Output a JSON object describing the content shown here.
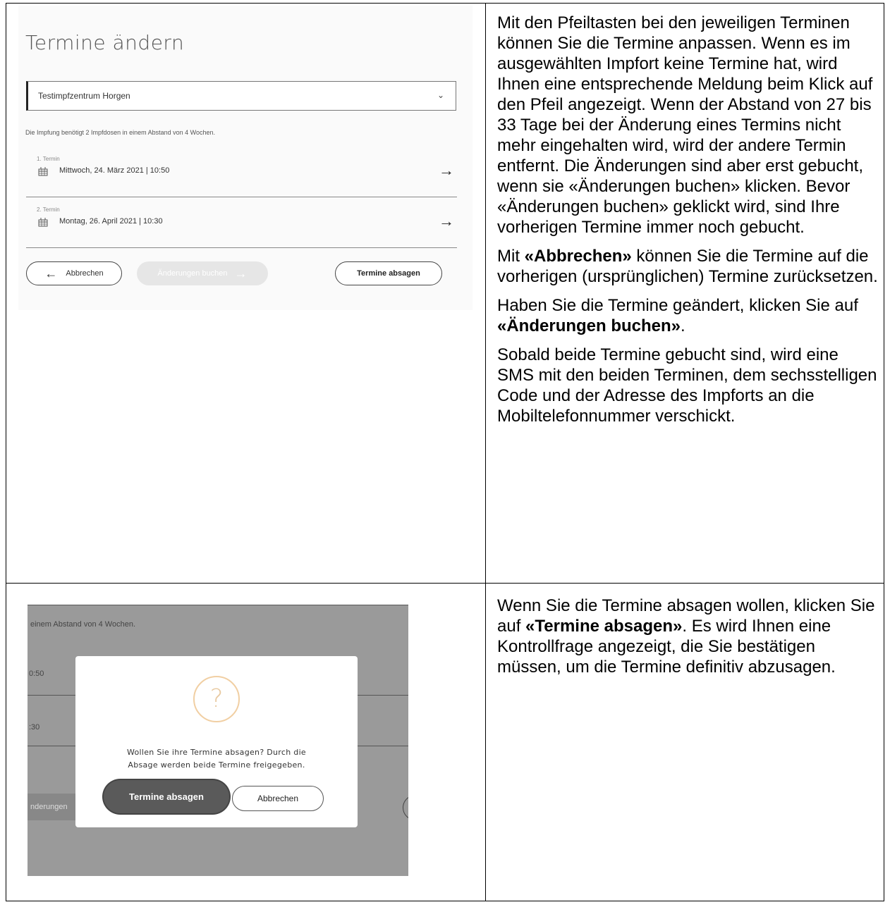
{
  "screen1": {
    "title": "Termine ändern",
    "location": "Testimpfzentrum Horgen",
    "info": "Die Impfung benötigt 2 Impfdosen in einem Abstand von 4 Wochen.",
    "appointments": [
      {
        "label": "1. Termin",
        "date": "Mittwoch, 24. März 2021 | 10:50"
      },
      {
        "label": "2. Termin",
        "date": "Montag, 26. April 2021 | 10:30"
      }
    ],
    "cancel_label": "Abbrechen",
    "book_label": "Änderungen buchen",
    "absagen_label": "Termine absagen"
  },
  "screen2": {
    "bg_info": "einem Abstand von 4 Wochen.",
    "bg_time1": "0:50",
    "bg_time2": ":30",
    "bg_button": "nderungen",
    "question_mark": "?",
    "modal_line1": "Wollen Sie ihre Termine absagen? Durch die",
    "modal_line2": "Absage werden beide Termine freigegeben.",
    "confirm_label": "Termine absagen",
    "abort_label": "Abbrechen"
  },
  "text": {
    "p1": "Mit den Pfeiltasten bei den jeweiligen Terminen können Sie die Termine anpassen. Wenn es im ausgewählten Impfort keine Termine hat, wird Ihnen eine entsprechende Meldung beim Klick auf den Pfeil angezeigt. Wenn der Abstand von 27 bis 33 Tage bei der Änderung eines Termins nicht mehr eingehalten wird, wird der andere Termin entfernt. Die Änderungen sind aber erst gebucht, wenn sie «Änderungen buchen» klicken. Bevor «Änderungen buchen» geklickt wird, sind Ihre vorherigen Termine immer noch gebucht.",
    "p2_pre": "Mit ",
    "p2_bold": "«Abbrechen»",
    "p2_post": " können Sie die Termine auf die vorherigen (ursprünglichen) Termine zurücksetzen.",
    "p3_pre": "Haben Sie die Termine geändert, klicken Sie auf ",
    "p3_bold": "«Änderungen buchen»",
    "p3_post": ".",
    "p4": "Sobald beide Termine gebucht sind, wird eine SMS mit den beiden Terminen, dem sechsstelligen Code und der Adresse des Impforts an die Mobiltelefonnummer verschickt.",
    "p5_pre": "Wenn Sie die Termine absagen wollen, klicken Sie auf ",
    "p5_bold": "«Termine absagen»",
    "p5_post": ". Es wird Ihnen eine Kontrollfrage angezeigt, die Sie bestätigen müssen, um die Termine definitiv abzusagen."
  }
}
